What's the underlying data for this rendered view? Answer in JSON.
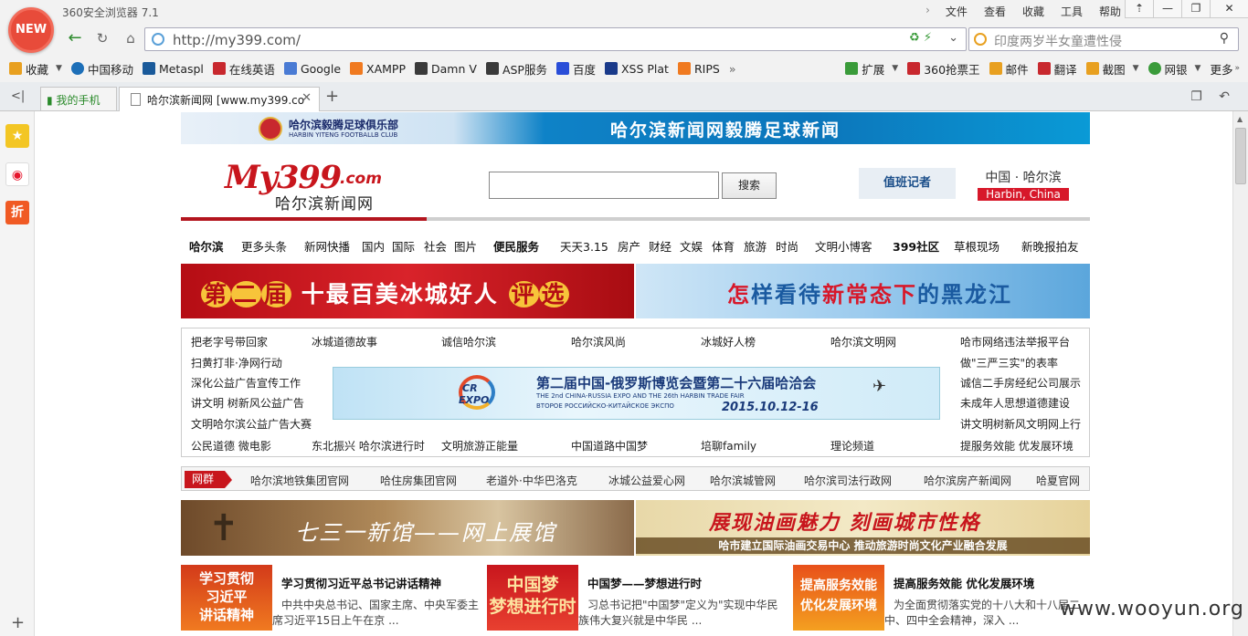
{
  "browser": {
    "badge": "NEW",
    "title": "360安全浏览器 7.1",
    "menu": [
      "文件",
      "查看",
      "收藏",
      "工具",
      "帮助"
    ],
    "window_controls": [
      "⇡",
      "—",
      "❐",
      "✕"
    ],
    "url": "http://my399.com/",
    "search_placeholder": "印度两岁半女童遭性侵",
    "bookmarks": [
      {
        "label": "收藏",
        "icon": "star-add-icon",
        "color": "#e8a020"
      },
      {
        "label": "中国移动",
        "icon": "china-mobile-icon",
        "color": "#1d6fb8"
      },
      {
        "label": "Metaspl",
        "icon": "metasploit-icon",
        "color": "#1a5a9a"
      },
      {
        "label": "在线英语",
        "icon": "english-icon",
        "color": "#c8282e"
      },
      {
        "label": "Google",
        "icon": "google-icon",
        "color": "#4a7bd4"
      },
      {
        "label": "XAMPP",
        "icon": "xampp-icon",
        "color": "#f07a20"
      },
      {
        "label": "Damn V",
        "icon": "dvwa-icon",
        "color": "#3a3a3a"
      },
      {
        "label": "ASP服务",
        "icon": "asp-icon",
        "color": "#3a3a3a"
      },
      {
        "label": "百度",
        "icon": "baidu-icon",
        "color": "#2a4ed8"
      },
      {
        "label": "XSS Plat",
        "icon": "xss-icon",
        "color": "#1a3a8a"
      },
      {
        "label": "RIPS",
        "icon": "rips-icon",
        "color": "#f07a20"
      }
    ],
    "bookmarks_right": [
      {
        "label": "扩展",
        "icon": "extensions-icon",
        "color": "#3a9b3a"
      },
      {
        "label": "360抢票王",
        "icon": "ticket-icon",
        "color": "#c8282e"
      },
      {
        "label": "邮件",
        "icon": "mail-icon",
        "color": "#e8a020"
      },
      {
        "label": "翻译",
        "icon": "translate-icon",
        "color": "#c8282e"
      },
      {
        "label": "截图",
        "icon": "screenshot-icon",
        "color": "#e8a020"
      },
      {
        "label": "网银",
        "icon": "bank-icon",
        "color": "#3a9b3a"
      },
      {
        "label": "更多",
        "icon": "more-icon",
        "color": "#888888"
      }
    ],
    "tabs": [
      {
        "label": "我的手机"
      },
      {
        "label": "哈尔滨新闻网 [www.my399.co"
      }
    ]
  },
  "site": {
    "top_banner": {
      "club_cn": "哈尔滨毅腾足球俱乐部",
      "club_en": "HARBIN YITENG FOOTBALLB CLUB",
      "title": "哈尔滨新闻网毅腾足球新闻"
    },
    "logo": {
      "main": "My399",
      "suffix": ".com",
      "sub": "哈尔滨新闻网"
    },
    "search_button": "搜索",
    "duty_reporter": "值班记者",
    "city": {
      "cn": "中国 · 哈尔滨",
      "en": "Harbin, China"
    },
    "nav": [
      {
        "label": "哈尔滨",
        "bold": true
      },
      {
        "label": "更多头条"
      },
      {
        "label": "新网快播"
      },
      {
        "label": "国内"
      },
      {
        "label": "国际"
      },
      {
        "label": "社会"
      },
      {
        "label": "图片"
      },
      {
        "label": "便民服务",
        "bold": true
      },
      {
        "label": "天天3.15"
      },
      {
        "label": "房产"
      },
      {
        "label": "财经"
      },
      {
        "label": "文娱"
      },
      {
        "label": "体育"
      },
      {
        "label": "旅游"
      },
      {
        "label": "时尚"
      },
      {
        "label": "文明小博客"
      },
      {
        "label": "399社区",
        "bold": true
      },
      {
        "label": "草根现场"
      },
      {
        "label": "新晚报拍友"
      }
    ],
    "banner1_left": {
      "c1": "第",
      "c2": "二",
      "c3": "届",
      "rest": "十最百美冰城好人",
      "c4": "评",
      "c5": "选"
    },
    "banner1_right": {
      "a": "怎",
      "b": "样看待",
      "c": "新常态",
      "d": "下",
      "e": "的黑龙江"
    },
    "links_col1": [
      "把老字号带回家",
      "扫黄打非·净网行动",
      "深化公益广告宣传工作",
      "讲文明 树新风公益广告",
      "文明哈尔滨公益广告大赛",
      "公民道德 微电影"
    ],
    "links_row1": [
      "冰城道德故事",
      "诚信哈尔滨",
      "哈尔滨风尚",
      "冰城好人榜",
      "哈尔滨文明网"
    ],
    "links_row6": [
      "东北振兴 哈尔滨进行时",
      "文明旅游正能量",
      "中国道路中国梦",
      "培聊family",
      "理论频道"
    ],
    "links_col7": [
      "哈市网络违法举报平台",
      "做\"三严三实\"的表率",
      "诚信二手房经纪公司展示",
      "未成年人思想道德建设",
      "讲文明树新风文明网上行",
      "提服务效能 优发展环境"
    ],
    "expo": {
      "logo_top": "CR",
      "logo_bottom": "EXPO",
      "cn": "第二届中国-俄罗斯博览会暨第二十六届哈洽会",
      "en": "THE 2nd CHINA-RUSSIA EXPO AND THE 26th HARBIN TRADE FAIR",
      "ru": "ВТОРОЕ РОССИЙСКО-КИТАЙСКОЕ ЭКСПО",
      "date": "2015.10.12-16"
    },
    "netbar": {
      "tag": "网群",
      "items": [
        "哈尔滨地铁集团官网",
        "哈住房集团官网",
        "老道外·中华巴洛克",
        "冰城公益爱心网",
        "哈尔滨城管网",
        "哈尔滨司法行政网",
        "哈尔滨房产新闻网",
        "哈夏官网"
      ]
    },
    "banner2_left": "七三一新馆——网上展馆",
    "banner2_right": {
      "title": "展现油画魅力 刻画城市性格",
      "sub": "哈市建立国际油画交易中心 推动旅游时尚文化产业融合发展"
    },
    "features": [
      {
        "thumb": "学习贯彻\n习近平\n讲话精神",
        "title": "学习贯彻习近平总书记讲话精神",
        "desc": "中共中央总书记、国家主席、中央军委主席习近平15日上午在京 ..."
      },
      {
        "thumb": "中国梦\n梦想进行时",
        "title": "中国梦——梦想进行时",
        "desc": "习总书记把\"中国梦\"定义为\"实现中华民族伟大复兴就是中华民 ..."
      },
      {
        "thumb": "提高服务效能\n优化发展环境",
        "title": "提高服务效能 优化发展环境",
        "desc": "为全面贯彻落实党的十八大和十八届二中、四中全会精神，深入 ..."
      }
    ]
  },
  "watermark": "www.wooyun.org",
  "colors": {
    "brand_red": "#c8161d",
    "accent_blue": "#1c4f8a",
    "browser_green": "#2e8b2e"
  }
}
